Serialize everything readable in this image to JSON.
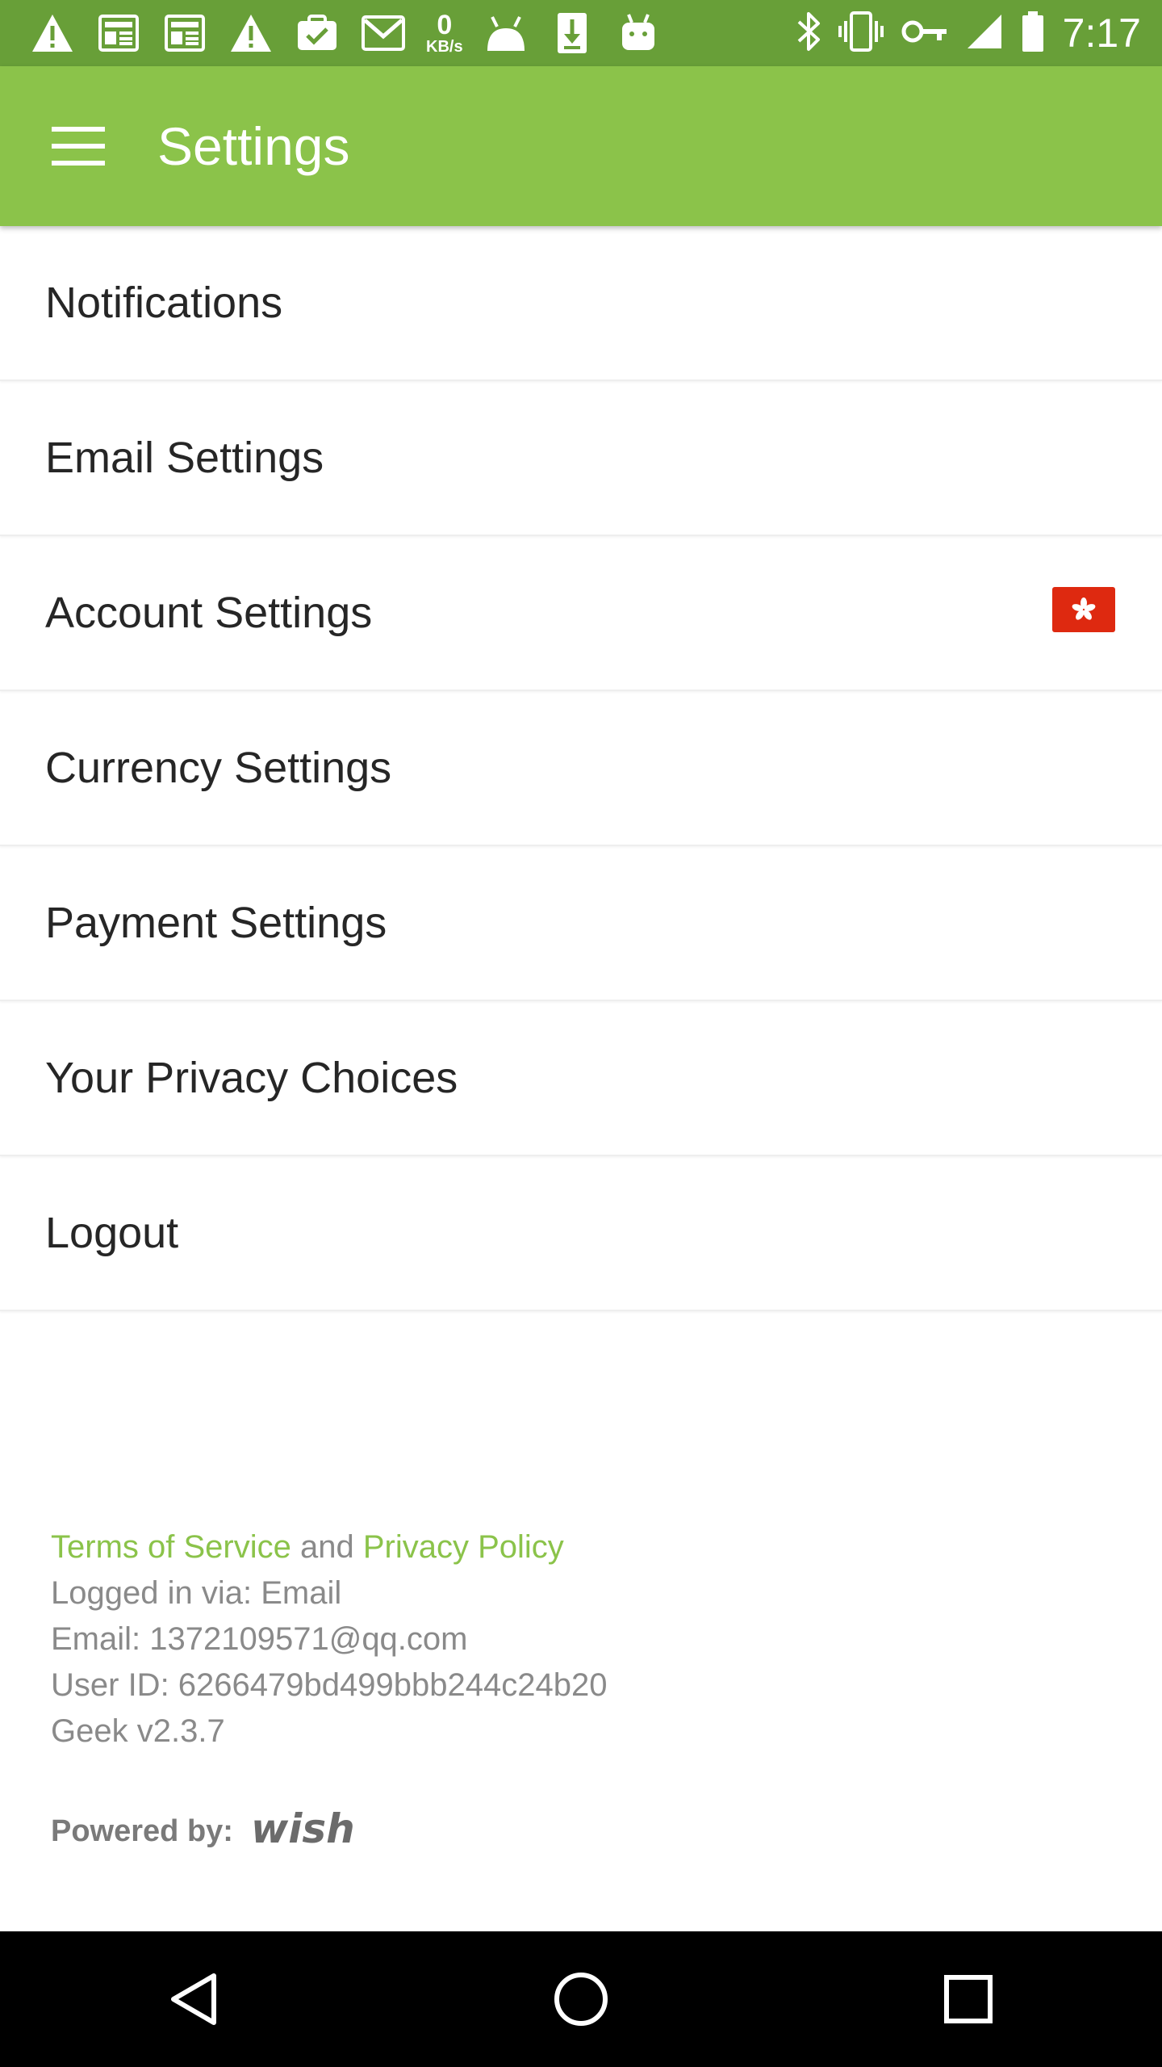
{
  "status_bar": {
    "time": "7:17",
    "speed_value": "0",
    "speed_unit": "KB/s",
    "left_icons": [
      "warning-icon",
      "news-icon",
      "news-icon",
      "warning-icon",
      "clipboard-check-icon",
      "gmail-icon",
      "speed-indicator",
      "android-icon",
      "download-icon",
      "android-icon"
    ],
    "right_icons": [
      "bluetooth-icon",
      "vibrate-icon",
      "key-icon",
      "signal-icon",
      "battery-icon"
    ]
  },
  "app_bar": {
    "menu_icon": "hamburger-menu-icon",
    "title": "Settings",
    "color": "#8bc34a"
  },
  "settings": {
    "items": [
      {
        "label": "Notifications"
      },
      {
        "label": "Email Settings"
      },
      {
        "label": "Account Settings",
        "badge": "hong-kong-flag-icon"
      },
      {
        "label": "Currency Settings"
      },
      {
        "label": "Payment Settings"
      },
      {
        "label": "Your Privacy Choices"
      },
      {
        "label": "Logout"
      }
    ]
  },
  "footer": {
    "terms_link": "Terms of Service",
    "and_text": " and ",
    "privacy_link": "Privacy Policy",
    "logged_in": "Logged in via: Email",
    "email": "Email: 1372109571@qq.com",
    "user_id": "User ID: 6266479bd499bbb244c24b20",
    "version": "Geek v2.3.7",
    "powered_by": "Powered by:",
    "logo_text": "wish"
  },
  "nav_bar": {
    "back_icon": "back-triangle-icon",
    "home_icon": "home-circle-icon",
    "recents_icon": "recents-square-icon"
  },
  "colors": {
    "status_bar": "#689f38",
    "accent": "#8bc34a",
    "text": "#262626",
    "muted": "#8a8a8a"
  }
}
